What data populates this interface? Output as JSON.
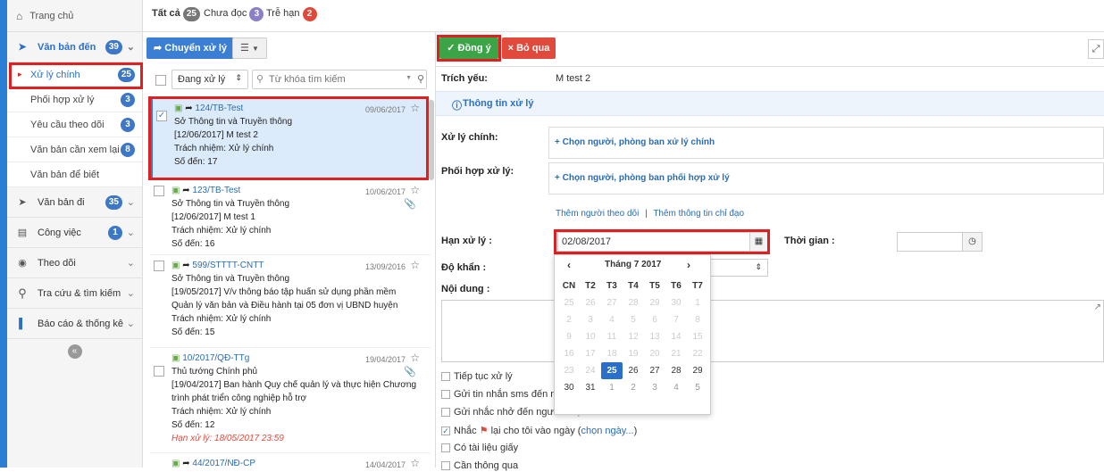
{
  "sidebar": {
    "home": "Trang chủ",
    "sections": [
      {
        "label": "Văn bản đến",
        "badge": "39"
      },
      {
        "label": "Văn bản đi",
        "badge": "35"
      },
      {
        "label": "Công việc",
        "badge": "1"
      },
      {
        "label": "Theo dõi"
      },
      {
        "label": "Tra cứu & tìm kiếm"
      },
      {
        "label": "Báo cáo & thống kê"
      }
    ],
    "sub_items": [
      {
        "label": "Xử lý chính",
        "badge": "25"
      },
      {
        "label": "Phối hợp xử lý",
        "badge": "3"
      },
      {
        "label": "Yêu cầu theo dõi",
        "badge": "3"
      },
      {
        "label": "Văn bản cần xem lại",
        "badge": "8"
      },
      {
        "label": "Văn bản để biết"
      }
    ]
  },
  "tabs": [
    {
      "label": "Tất cả",
      "badge": "25"
    },
    {
      "label": "Chưa đọc",
      "badge": "3"
    },
    {
      "label": "Trễ hạn",
      "badge": "2"
    }
  ],
  "list": {
    "forward_button": "Chuyển xử lý",
    "filter_value": "Đang xử lý",
    "search_placeholder": "Từ khóa tìm kiếm",
    "items": [
      {
        "code": "124/TB-Test",
        "date": "09/06/2017",
        "org": "Sở Thông tin và Truyền thông",
        "summary": "[12/06/2017] M test 2",
        "responsibility": "Trách nhiệm: Xử lý chính",
        "number": "Số đến: 17"
      },
      {
        "code": "123/TB-Test",
        "date": "10/06/2017",
        "org": "Sở Thông tin và Truyền thông",
        "summary": "[12/06/2017] M test 1",
        "responsibility": "Trách nhiệm: Xử lý chính",
        "number": "Số đến: 16"
      },
      {
        "code": "599/STTTT-CNTT",
        "date": "13/09/2016",
        "org": "Sở Thông tin và Truyền thông",
        "summary": "[19/05/2017] V/v thông báo tập huấn sử dụng phần mềm Quản lý văn bản và Điều hành tại 05 đơn vị UBND huyện",
        "responsibility": "Trách nhiệm: Xử lý chính",
        "number": "Số đến: 15"
      },
      {
        "code": "10/2017/QĐ-TTg",
        "date": "19/04/2017",
        "org": "Thủ tướng Chính phủ",
        "summary": "[19/04/2017] Ban hành Quy chế quản lý và thực hiện Chương trình phát triển công nghiệp hỗ trợ",
        "responsibility": "Trách nhiệm: Xử lý chính",
        "number": "Số đến: 12",
        "deadline": "Hạn xử lý: 18/05/2017 23:59"
      },
      {
        "code": "44/2017/NĐ-CP",
        "date": "14/04/2017"
      }
    ]
  },
  "detail": {
    "approve_button": "Đồng ý",
    "skip_button": "Bỏ qua",
    "trich_yeu_label": "Trích yếu:",
    "trich_yeu_value": "M test 2",
    "info_tab": "Thông tin xử lý",
    "main_label": "Xử lý chính:",
    "main_link": "+ Chọn người, phòng ban xử lý chính",
    "coord_label": "Phối hợp xử lý:",
    "coord_link": "+ Chọn người, phòng ban phối hợp xử lý",
    "add_follower": "Thêm người theo dõi",
    "separator": "|",
    "add_directive": "Thêm thông tin chỉ đạo",
    "deadline_label": "Hạn xử lý :",
    "deadline_value": "02/08/2017",
    "time_label": "Thời gian :",
    "urgency_label": "Độ khẩn :",
    "content_label": "Nội dung :",
    "checks": [
      {
        "label": "Tiếp tục xử lý",
        "checked": false
      },
      {
        "label": "Gửi tin nhắn sms đến n",
        "checked": false
      },
      {
        "label": "Gửi nhắc nhở đến người nhận",
        "checked": false
      },
      {
        "label": "Nhắc",
        "checked": true,
        "rest": "lại cho tôi vào ngày (",
        "link": "chọn ngày...",
        "end": ")"
      },
      {
        "label": "Có tài liệu giấy",
        "checked": false
      },
      {
        "label": "Cần thông qua",
        "checked": false
      }
    ]
  },
  "calendar": {
    "month_label": "Tháng 7 2017",
    "prev": "‹",
    "next": "›",
    "weekdays": [
      "CN",
      "T2",
      "T3",
      "T4",
      "T5",
      "T6",
      "T7"
    ],
    "weeks": [
      [
        "25",
        "26",
        "27",
        "28",
        "29",
        "30",
        "1"
      ],
      [
        "2",
        "3",
        "4",
        "5",
        "6",
        "7",
        "8"
      ],
      [
        "9",
        "10",
        "11",
        "12",
        "13",
        "14",
        "15"
      ],
      [
        "16",
        "17",
        "18",
        "19",
        "20",
        "21",
        "22"
      ],
      [
        "23",
        "24",
        "25",
        "26",
        "27",
        "28",
        "29"
      ],
      [
        "30",
        "31",
        "1",
        "2",
        "3",
        "4",
        "5"
      ]
    ],
    "selected": "25"
  }
}
